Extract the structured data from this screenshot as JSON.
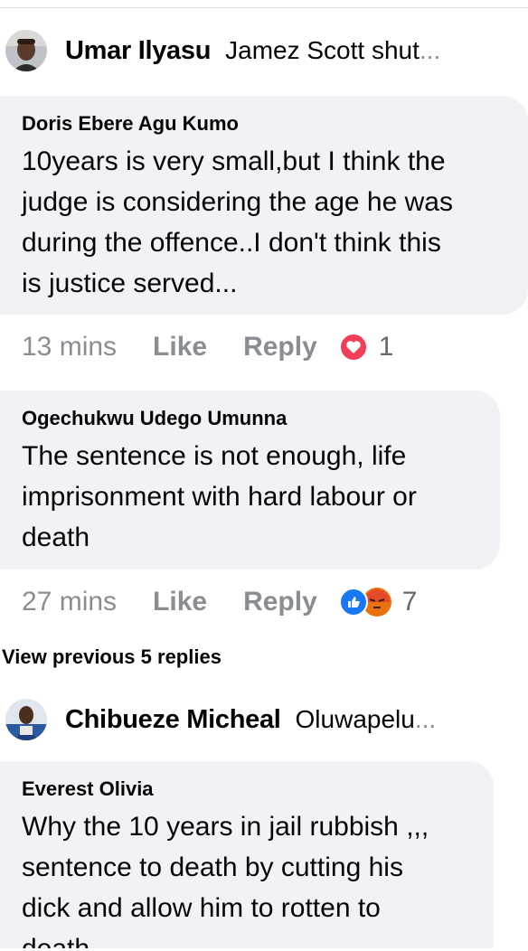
{
  "threads": [
    {
      "reply_author": "Umar Ilyasu",
      "reply_snippet": "Jamez Scott shut",
      "ellipsis": "..."
    },
    {
      "reply_author": "Chibueze Micheal",
      "reply_snippet": "Oluwapelu",
      "ellipsis": "..."
    }
  ],
  "comments": [
    {
      "author": "Doris Ebere Agu Kumo",
      "lines": [
        "10years is very small,but I think the",
        "judge is considering the age he was",
        "during the offence..I don't think this",
        "is justice served..."
      ],
      "time": "13 mins",
      "like": "Like",
      "reply": "Reply",
      "reactions": [
        "love-icon"
      ],
      "reaction_count": "1"
    },
    {
      "author": "Ogechukwu Udego Umunna",
      "lines": [
        "The sentence is not enough, life",
        "imprisonment with hard labour or",
        "death"
      ],
      "time": "27 mins",
      "like": "Like",
      "reply": "Reply",
      "reactions": [
        "like-icon",
        "angry-icon"
      ],
      "reaction_count": "7"
    },
    {
      "author": "Everest Olivia",
      "lines": [
        "Why the 10 years in jail rubbish ,,,",
        "sentence to death by cutting his",
        "dick and allow him to rotten to",
        "death"
      ]
    }
  ],
  "view_previous": "View previous 5 replies",
  "colors": {
    "bubble": "#f0f2f5",
    "meta_text": "#8a8d91",
    "love": "#f33e58",
    "like": "#1877f2",
    "angry": "#e9710f"
  }
}
